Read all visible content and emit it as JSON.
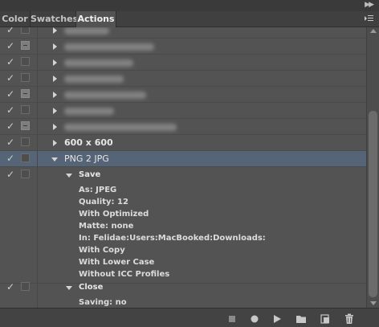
{
  "tabs": [
    {
      "label": "Color",
      "active": false
    },
    {
      "label": "Swatches",
      "active": false
    },
    {
      "label": "Actions",
      "active": true
    }
  ],
  "actions": [
    {
      "name": "",
      "blurred": true,
      "dialog": false
    },
    {
      "name": "",
      "blurred": true,
      "dialog": true
    },
    {
      "name": "",
      "blurred": true,
      "dialog": false
    },
    {
      "name": "",
      "blurred": true,
      "dialog": false
    },
    {
      "name": "",
      "blurred": true,
      "dialog": true
    },
    {
      "name": "",
      "blurred": true,
      "dialog": false
    },
    {
      "name": "",
      "blurred": true,
      "dialog": true
    },
    {
      "name": "600 x 600",
      "blurred": false,
      "dialog": false
    },
    {
      "name": "PNG 2 JPG",
      "blurred": false,
      "dialog": false,
      "selected": true,
      "expanded": true
    }
  ],
  "steps": [
    {
      "name": "Save",
      "params": [
        "As: JPEG",
        "Quality: 12",
        "With Optimized",
        "Matte: none",
        "In: Felidae:Users:MacBooked:Downloads:",
        "With Copy",
        "With Lower Case",
        "Without ICC Profiles"
      ]
    },
    {
      "name": "Close",
      "params": [
        "Saving: no"
      ]
    }
  ],
  "icons": {
    "check": "✓",
    "toolbar": [
      "stop-icon",
      "record-icon",
      "play-icon",
      "new-set-icon",
      "new-action-icon",
      "delete-icon"
    ]
  },
  "colors": {
    "panel": "#535353",
    "selected_row": "#566478"
  }
}
